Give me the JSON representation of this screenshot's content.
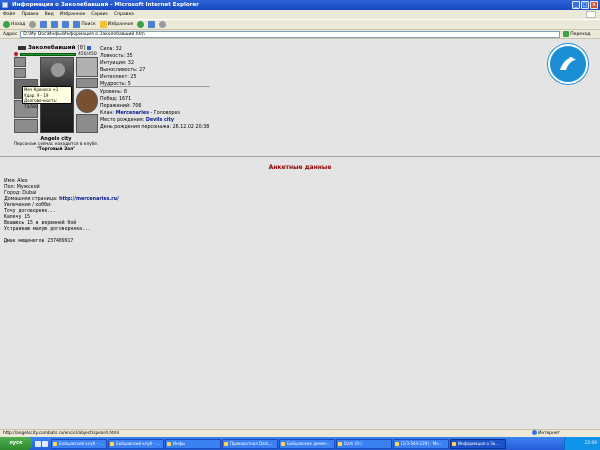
{
  "window": {
    "title": "Информация о Заколебавший - Microsoft Internet Explorer"
  },
  "menu": [
    "Файл",
    "Правка",
    "Вид",
    "Избранное",
    "Сервис",
    "Справка"
  ],
  "toolbar": {
    "back": "Назад",
    "search": "Поиск",
    "favorites": "Избранное"
  },
  "address": {
    "label": "Адрес",
    "value": "D:\\Му Doc\\Инфы\\Информация о Заколебавший.htm",
    "go": "Переход"
  },
  "character": {
    "name": "Заколебавший",
    "level": "[8]",
    "hp": "450/450",
    "tooltip": [
      "Меч Кроноса +1",
      "Удар: 9 - 19",
      "Долговечность: 73/500"
    ],
    "city": "Angels city",
    "club_note": [
      "Персонаж сейчас находится в клубе.",
      "\"Торговый Зал\""
    ]
  },
  "stats": [
    {
      "label": "Сила",
      "value": "32"
    },
    {
      "label": "Ловкость",
      "value": "35"
    },
    {
      "label": "Интуиция",
      "value": "32"
    },
    {
      "label": "Выносливость",
      "value": "27"
    },
    {
      "label": "Интеллект",
      "value": "25"
    },
    {
      "label": "Мудрость",
      "value": "5"
    }
  ],
  "records": {
    "level_label": "Уровень",
    "level_value": "8",
    "wins_label": "Побед",
    "wins_value": "1671",
    "losses_label": "Поражений",
    "losses_value": "706",
    "clan_label": "Клан",
    "clan_value": "Mercenaries",
    "clan_role": "- Головорез",
    "birthplace_label": "Место рождения",
    "birthplace_value": "Devils city",
    "birthday_label": "День рождения персонажа",
    "birthday_value": "26.12.02 20:38"
  },
  "anketa": {
    "title": "Анкетные данные",
    "name": "Имя: Alex",
    "gender": "Пол: Мужской",
    "city": "Город: Dubai",
    "homepage_label": "Домашняя страница:",
    "homepage_link": "http://mercenaries.ru/",
    "hobby": "Увлечения / хобби:",
    "lines": [
      "Точу договорняк...",
      "Калечу 15",
      "Вешаюсь 15 в вервиней бой",
      "Устраиваю малую договорняка..."
    ],
    "icq": "Дмак мещенегов 237409917"
  },
  "status": {
    "text": "http://angelscity.combats.ru/encicl/object/spear4.html",
    "zone": "Интернет"
  },
  "taskbar": {
    "start": "пуск",
    "items": [
      "Бойцовский клуб - ...",
      "Бойцовский клуб - ...",
      "Инфы",
      "Приворотная Dark...",
      "Бойцовские демен...",
      "Dark (0:) ",
      "[2/3-544-229] - Ме...",
      "Информация о За..."
    ],
    "clock": "22:09"
  },
  "colors": {
    "titlebar": "#245edb",
    "link": "#001a8c",
    "anketa_title": "#8b0000",
    "hp_bar": "#1a9a2a",
    "logo": "#1b8fd6"
  }
}
